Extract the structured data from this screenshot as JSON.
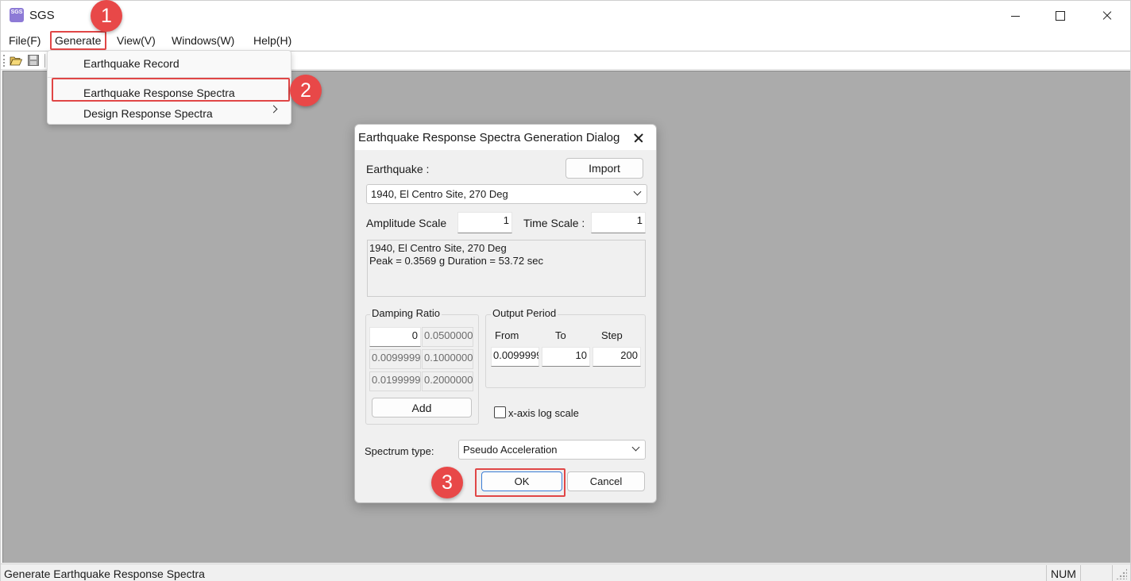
{
  "app": {
    "title": "SGS",
    "icon_text": "SGS"
  },
  "window_controls": {
    "minimize_icon": "minimize-icon",
    "maximize_icon": "maximize-icon",
    "close_icon": "close-icon"
  },
  "menubar": {
    "file": "File(F)",
    "generate": "Generate",
    "view": "View(V)",
    "windows": "Windows(W)",
    "help": "Help(H)"
  },
  "toolbar": {
    "open_icon": "open-folder-icon",
    "save_icon": "save-disk-icon"
  },
  "generate_menu": {
    "items": [
      {
        "label": "Earthquake Record"
      },
      {
        "label": "Earthquake Response Spectra",
        "highlighted": true
      },
      {
        "label": "Design Response Spectra",
        "has_submenu": true
      }
    ]
  },
  "annotations": {
    "badge1": "1",
    "badge2": "2",
    "badge3": "3",
    "highlight_color": "#e04646"
  },
  "dialog": {
    "title": "Earthquake Response Spectra Generation Dialog",
    "earthquake_label": "Earthquake :",
    "import_button": "Import",
    "earthquake_selected": "1940, El Centro Site, 270 Deg",
    "amplitude_scale_label": "Amplitude Scale",
    "amplitude_scale_value": "1",
    "time_scale_label": "Time Scale :",
    "time_scale_value": "1",
    "info_line1": "1940, El Centro Site, 270 Deg",
    "info_line2": "Peak = 0.3569 g  Duration = 53.72 sec",
    "damping": {
      "title": "Damping Ratio",
      "values": [
        [
          "0",
          "0.0500000"
        ],
        [
          "0.0099999",
          "0.1000000"
        ],
        [
          "0.0199999",
          "0.2000000"
        ]
      ],
      "add_button": "Add"
    },
    "output_period": {
      "title": "Output Period",
      "from_label": "From",
      "to_label": "To",
      "step_label": "Step",
      "from_value": "0.0099999",
      "to_value": "10",
      "step_value": "200"
    },
    "log_scale_label": "x-axis log scale",
    "log_scale_checked": false,
    "spectrum_type_label": "Spectrum type:",
    "spectrum_type_value": "Pseudo Acceleration",
    "ok_button": "OK",
    "cancel_button": "Cancel"
  },
  "statusbar": {
    "text": "Generate Earthquake Response Spectra",
    "num": "NUM"
  }
}
